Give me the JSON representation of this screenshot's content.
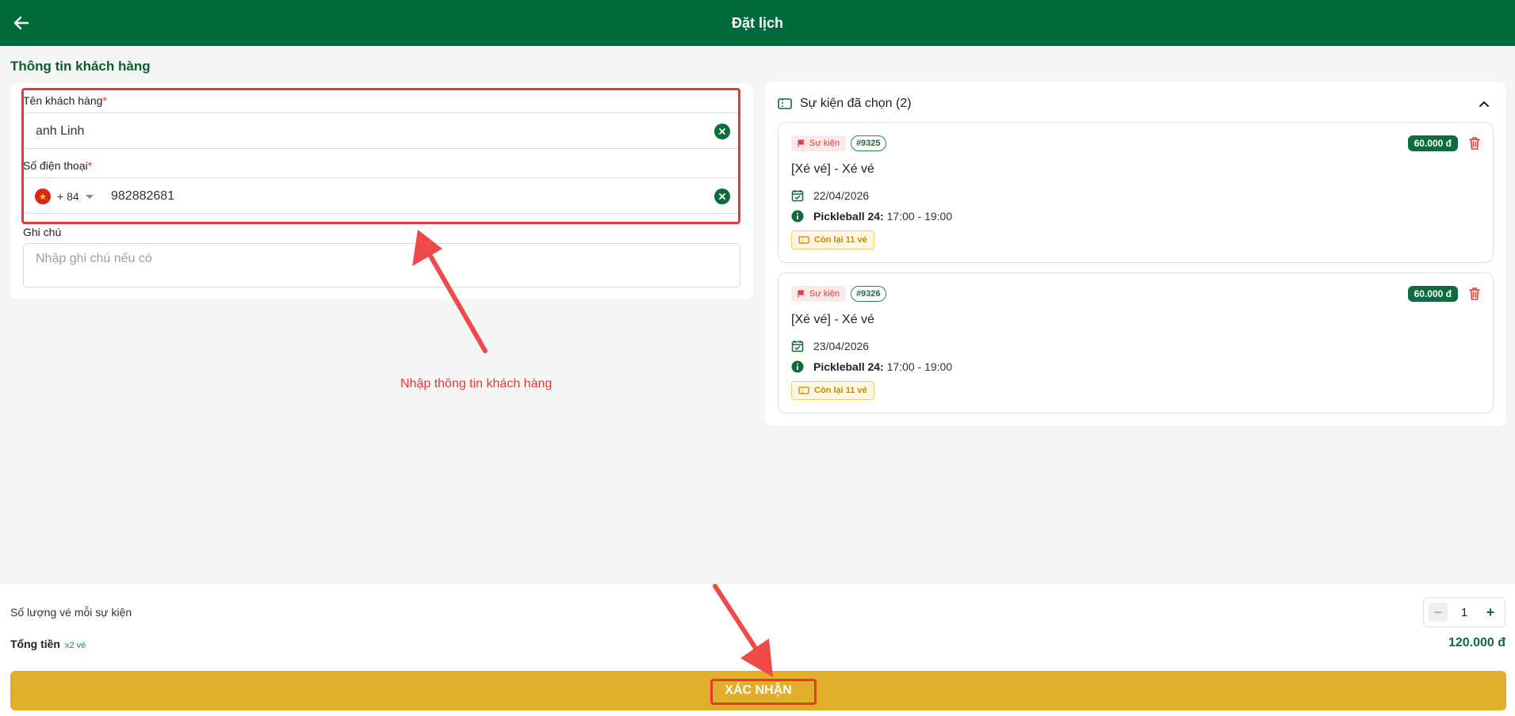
{
  "header": {
    "title": "Đặt lịch"
  },
  "customer": {
    "section_title": "Thông tin khách hàng",
    "name_label": "Tên khách hàng",
    "name_value": "anh Linh",
    "phone_label": "Số điện thoại",
    "phone_prefix": "+ 84",
    "phone_value": "982882681",
    "note_label": "Ghi chú",
    "note_placeholder": "Nhập ghi chú nếu có",
    "required_mark": "*"
  },
  "events": {
    "header": "Sự kiện đã chọn (2)",
    "items": [
      {
        "tag": "Sự kiện",
        "id": "#9325",
        "price": "60.000 đ",
        "title": "[Xé vé] - Xé vé",
        "date": "22/04/2026",
        "court": "Pickleball 24:",
        "time": "17:00 - 19:00",
        "remaining": "Còn lại 11 vé"
      },
      {
        "tag": "Sự kiện",
        "id": "#9326",
        "price": "60.000 đ",
        "title": "[Xé vé] - Xé vé",
        "date": "23/04/2026",
        "court": "Pickleball 24:",
        "time": "17:00 - 19:00",
        "remaining": "Còn lại 11 vé"
      }
    ]
  },
  "annotation": {
    "text": "Nhập thông tin khách hàng"
  },
  "footer": {
    "qty_label": "Số lượng vé mỗi sự kiện",
    "qty_value": "1",
    "total_label": "Tổng tiền",
    "total_sub": "x2 vé",
    "total_value": "120.000 đ",
    "confirm_label": "XÁC NHẬN"
  },
  "colors": {
    "brand_green": "#006b3a",
    "confirm_yellow": "#e0ae2a",
    "annotation_red": "#e53935"
  }
}
